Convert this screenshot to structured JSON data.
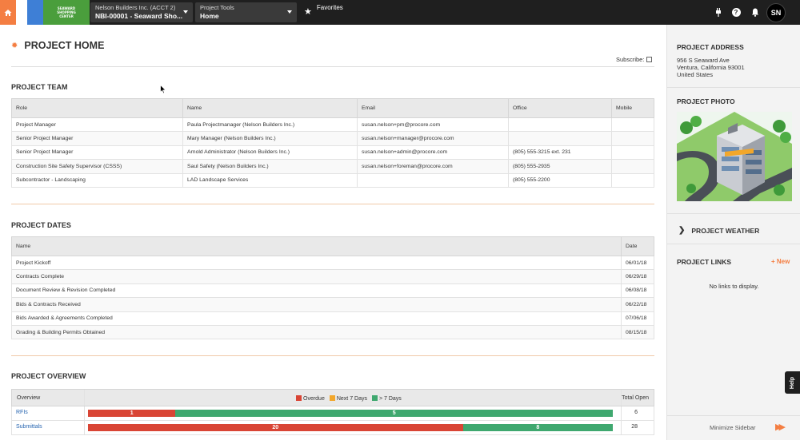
{
  "topbar": {
    "logo_lines": [
      "SEAWARD",
      "SHOPPING",
      "CENTER"
    ],
    "company_label": "Nelson Builders Inc. (ACCT 2)",
    "project_label": "NBI-00001 - Seaward Sho...",
    "tools_label": "Project Tools",
    "tools_value": "Home",
    "favorites_label": "Favorites",
    "avatar_initials": "SN"
  },
  "page": {
    "title": "PROJECT HOME",
    "subscribe_label": "Subscribe:"
  },
  "team": {
    "title": "PROJECT TEAM",
    "columns": [
      "Role",
      "Name",
      "Email",
      "Office",
      "Mobile"
    ],
    "rows": [
      [
        "Project Manager",
        "Paula Projectmanager (Nelson Builders Inc.)",
        "susan.nelson+pm@procore.com",
        "",
        ""
      ],
      [
        "Senior Project Manager",
        "Mary Manager (Nelson Builders Inc.)",
        "susan.nelson+manager@procore.com",
        "",
        ""
      ],
      [
        "Senior Project Manager",
        "Arnold Administrator (Nelson Builders Inc.)",
        "susan.nelson+admin@procore.com",
        "(805) 555-3215 ext. 231",
        ""
      ],
      [
        "Construction Site Safety Supervisor (CSSS)",
        "Saul Safety (Nelson Builders Inc.)",
        "susan.nelson+foreman@procore.com",
        "(805) 555-2935",
        ""
      ],
      [
        "Subcontractor - Landscaping",
        "LAD Landscape Services",
        "",
        "(805) 555-2200",
        ""
      ]
    ]
  },
  "dates": {
    "title": "PROJECT DATES",
    "columns": [
      "Name",
      "Date"
    ],
    "rows": [
      [
        "Project Kickoff",
        "06/01/18"
      ],
      [
        "Contracts Complete",
        "06/29/18"
      ],
      [
        "Document Review & Revision Completed",
        "06/08/18"
      ],
      [
        "Bids & Contracts Received",
        "06/22/18"
      ],
      [
        "Bids Awarded & Agreements Completed",
        "07/06/18"
      ],
      [
        "Grading & Building Permits Obtained",
        "08/15/18"
      ]
    ]
  },
  "overview": {
    "title": "PROJECT OVERVIEW",
    "col_overview": "Overview",
    "col_total": "Total Open",
    "legend": [
      {
        "label": "Overdue",
        "color": "#d94535"
      },
      {
        "label": "Next 7 Days",
        "color": "#f2a72b"
      },
      {
        "label": "> 7 Days",
        "color": "#3fa86f"
      }
    ],
    "rows": [
      {
        "label": "RFIs",
        "overdue": 1,
        "next7": 0,
        "later": 5,
        "total": "6"
      },
      {
        "label": "Submittals",
        "overdue": 20,
        "next7": 0,
        "later": 8,
        "total": "28"
      }
    ]
  },
  "sidebar": {
    "address_title": "PROJECT ADDRESS",
    "address_lines": [
      "956 S Seaward Ave",
      "Ventura, California 93001",
      "United States"
    ],
    "photo_title": "PROJECT PHOTO",
    "weather_title": "PROJECT WEATHER",
    "links_title": "PROJECT LINKS",
    "new_label": "+ New",
    "no_links": "No links to display.",
    "minimize_label": "Minimize Sidebar",
    "help_label": "Help"
  },
  "colors": {
    "accent": "#f47e42",
    "topbar": "#1f1f1f"
  }
}
